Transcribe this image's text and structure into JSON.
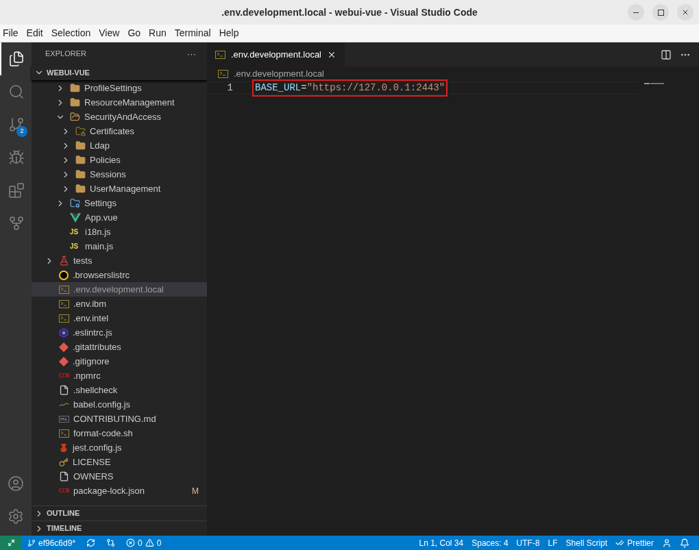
{
  "window": {
    "title": ".env.development.local - webui-vue - Visual Studio Code"
  },
  "menu": [
    "File",
    "Edit",
    "Selection",
    "View",
    "Go",
    "Run",
    "Terminal",
    "Help"
  ],
  "activity_bar": {
    "top": [
      {
        "kind": "explorer",
        "selected": true
      },
      {
        "kind": "search",
        "selected": false
      },
      {
        "kind": "source-control",
        "selected": false,
        "badge": "2"
      },
      {
        "kind": "run-debug",
        "selected": false
      },
      {
        "kind": "extensions",
        "selected": false
      },
      {
        "kind": "git-graph",
        "selected": false
      }
    ],
    "bottom": [
      {
        "kind": "account"
      },
      {
        "kind": "settings"
      }
    ]
  },
  "explorer": {
    "title": "EXPLORER",
    "more": "···",
    "workspace": {
      "label": "WEBUI-VUE",
      "expanded": true
    },
    "nested": [
      {
        "label": "ProfileSettings",
        "kind": "folder",
        "expanded": false
      },
      {
        "label": "ResourceManagement",
        "kind": "folder",
        "expanded": false
      },
      {
        "label": "SecurityAndAccess",
        "kind": "folder",
        "expanded": true,
        "children": [
          {
            "label": "Certificates",
            "kind": "folder-lock",
            "expanded": false
          },
          {
            "label": "Ldap",
            "kind": "folder",
            "expanded": false
          },
          {
            "label": "Policies",
            "kind": "folder",
            "expanded": false
          },
          {
            "label": "Sessions",
            "kind": "folder",
            "expanded": false
          },
          {
            "label": "UserManagement",
            "kind": "folder",
            "expanded": false
          }
        ]
      },
      {
        "label": "Settings",
        "kind": "folder-settings",
        "expanded": false
      },
      {
        "label": "App.vue",
        "kind": "vue"
      },
      {
        "label": "i18n.js",
        "kind": "js",
        "icon_label": "JS"
      },
      {
        "label": "main.js",
        "kind": "js",
        "icon_label": "JS"
      }
    ],
    "root": [
      {
        "label": "tests",
        "kind": "folder-test",
        "expanded": false,
        "selected": false
      },
      {
        "label": ".browserslistrc",
        "kind": "browserslist",
        "selected": false
      },
      {
        "label": ".env.development.local",
        "kind": "env",
        "selected": true
      },
      {
        "label": ".env.ibm",
        "kind": "env",
        "selected": false
      },
      {
        "label": ".env.intel",
        "kind": "env",
        "selected": false
      },
      {
        "label": ".eslintrc.js",
        "kind": "eslint",
        "selected": false
      },
      {
        "label": ".gitattributes",
        "kind": "git",
        "selected": false
      },
      {
        "label": ".gitignore",
        "kind": "git",
        "selected": false
      },
      {
        "label": ".npmrc",
        "kind": "npm",
        "selected": false
      },
      {
        "label": ".shellcheck",
        "kind": "file",
        "selected": false
      },
      {
        "label": "babel.config.js",
        "kind": "babel",
        "selected": false
      },
      {
        "label": "CONTRIBUTING.md",
        "kind": "markdown",
        "selected": false
      },
      {
        "label": "format-code.sh",
        "kind": "env",
        "selected": false
      },
      {
        "label": "jest.config.js",
        "kind": "jest",
        "selected": false
      },
      {
        "label": "LICENSE",
        "kind": "license",
        "selected": false
      },
      {
        "label": "OWNERS",
        "kind": "file",
        "selected": false
      },
      {
        "label": "package-lock.json",
        "kind": "npm",
        "selected": false,
        "badge": "M"
      }
    ],
    "sections": [
      {
        "label": "OUTLINE",
        "expanded": false
      },
      {
        "label": "TIMELINE",
        "expanded": false
      }
    ]
  },
  "editor": {
    "tabs": [
      {
        "label": ".env.development.local",
        "selected": true
      }
    ],
    "breadcrumb": ".env.development.local",
    "lines": [
      {
        "number": "1",
        "tokens": [
          {
            "kind": "key",
            "text": "BASE_URL"
          },
          {
            "kind": "operator",
            "text": "="
          },
          {
            "kind": "string",
            "text": "\"https://127.0.0.1:2443\""
          }
        ],
        "highlighted": true
      }
    ]
  },
  "status_bar": {
    "branch": "ef96c6d9*",
    "errors": "0",
    "warnings": "0",
    "right": [
      {
        "kind": "text",
        "text": "Ln 1, Col 34"
      },
      {
        "kind": "text",
        "text": "Spaces: 4"
      },
      {
        "kind": "text",
        "text": "UTF-8"
      },
      {
        "kind": "text",
        "text": "LF"
      },
      {
        "kind": "text",
        "text": "Shell Script"
      },
      {
        "kind": "prettier",
        "text": "Prettier"
      },
      {
        "kind": "account"
      },
      {
        "kind": "bell"
      }
    ]
  }
}
